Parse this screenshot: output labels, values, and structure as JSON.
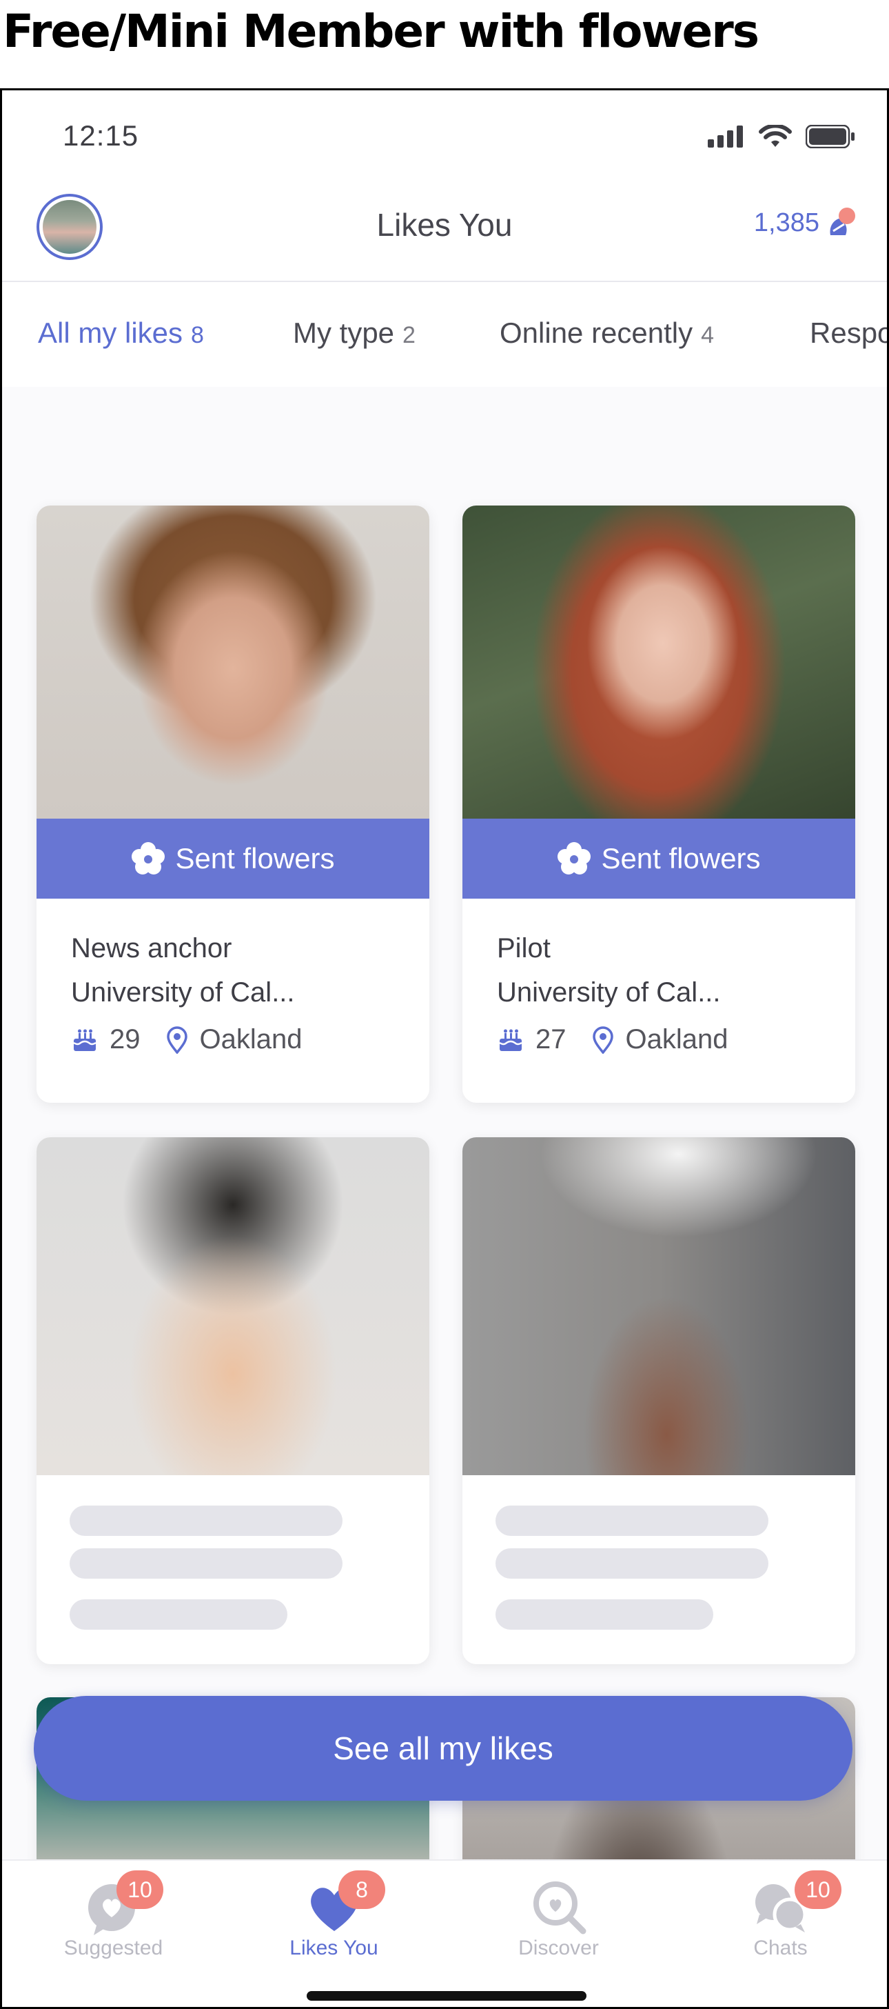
{
  "page_heading": "Free/Mini Member with flowers",
  "status_bar": {
    "time": "12:15"
  },
  "header": {
    "title": "Likes You",
    "credits": "1,385"
  },
  "tabs": [
    {
      "label": "All my likes",
      "count": "8",
      "active": true
    },
    {
      "label": "My type",
      "count": "2",
      "active": false
    },
    {
      "label": "Online recently",
      "count": "4",
      "active": false
    },
    {
      "label": "Respo",
      "count": "",
      "active": false
    }
  ],
  "cards": [
    {
      "badge": "Sent flowers",
      "job": "News anchor",
      "school": "University of Cal...",
      "age": "29",
      "location": "Oakland"
    },
    {
      "badge": "Sent flowers",
      "job": "Pilot",
      "school": "University of Cal...",
      "age": "27",
      "location": "Oakland"
    }
  ],
  "cta": {
    "label": "See all my likes"
  },
  "nav": [
    {
      "label": "Suggested",
      "badge": "10",
      "icon": "heart-bubble-icon"
    },
    {
      "label": "Likes You",
      "badge": "8",
      "icon": "heart-icon"
    },
    {
      "label": "Discover",
      "badge": "",
      "icon": "discover-search-icon"
    },
    {
      "label": "Chats",
      "badge": "10",
      "icon": "chat-bubbles-icon"
    }
  ],
  "colors": {
    "accent": "#5b6dd1",
    "badge": "#f2837a",
    "flowers_bar": "#6876d3"
  }
}
